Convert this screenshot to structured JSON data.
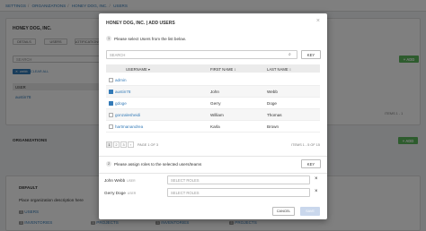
{
  "breadcrumb": [
    "SETTINGS",
    "ORGANIZATIONS",
    "HONEY DOG, INC.",
    "USERS"
  ],
  "bg": {
    "org_title": "HONEY DOG, INC.",
    "tabs": [
      "DETAILS",
      "USERS",
      "NOTIFICATIONS"
    ],
    "search_placeholder": "SEARCH",
    "add_label": "+ ADD",
    "tag_label": "webb",
    "clear_all": "CLEAR ALL",
    "user_col": "USER",
    "user_value": "austin78",
    "items_label": "ITEMS 1 - 1",
    "organizations_label": "ORGANIZATIONS",
    "default_label": "DEFAULT",
    "default_desc": "Place organization description here",
    "users_label": "USERS",
    "inventories_label": "INVENTORIES",
    "projects_label": "PROJECTS",
    "inventories_label2": "INVENTORIES",
    "projects_label2": "PROJECTS"
  },
  "modal": {
    "title": "HONEY DOG, INC.  |  ADD USERS",
    "step1_num": "1",
    "step1_text": "Please select Users from the list below.",
    "search_placeholder": "SEARCH",
    "key_label": "KEY",
    "columns": [
      "USERNAME",
      "FIRST NAME",
      "LAST NAME"
    ],
    "rows": [
      {
        "username": "admin",
        "first": "",
        "last": "",
        "checked": false
      },
      {
        "username": "austin78",
        "first": "John",
        "last": "Webb",
        "checked": true
      },
      {
        "username": "gdoge",
        "first": "Gerry",
        "last": "Doge",
        "checked": true
      },
      {
        "username": "gonzalesheidi",
        "first": "William",
        "last": "Thomas",
        "checked": false
      },
      {
        "username": "hartmanandrea",
        "first": "Karla",
        "last": "Brown",
        "checked": false
      }
    ],
    "pager": {
      "pages": [
        "1",
        "2",
        "3"
      ],
      "page_text": "PAGE 1 OF 3",
      "items_text": "ITEMS 1 - 5 OF 15"
    },
    "step2_num": "2",
    "step2_text": "Please assign roles to the selected users/teams",
    "key_label2": "KEY",
    "assignments": [
      {
        "name": "John Webb",
        "type": "USER",
        "placeholder": "SELECT ROLES"
      },
      {
        "name": "Gerry Doge",
        "type": "USER",
        "placeholder": "SELECT ROLES"
      }
    ],
    "cancel_label": "CANCEL",
    "save_label": "SAVE"
  }
}
